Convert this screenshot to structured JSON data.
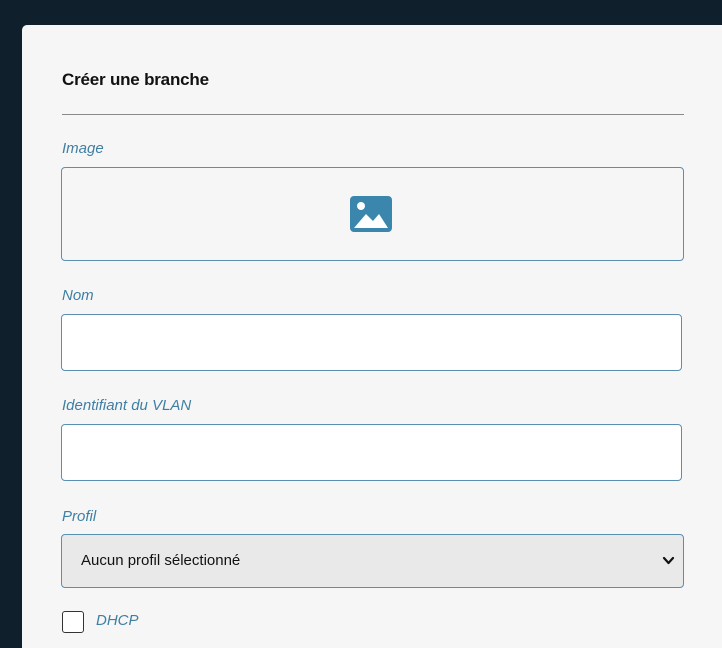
{
  "form": {
    "title": "Créer une branche",
    "image_label": "Image",
    "image_icon": "image-icon",
    "name_label": "Nom",
    "name_value": "",
    "vlan_label": "Identifiant du VLAN",
    "vlan_value": "",
    "profile_label": "Profil",
    "profile_selected": "Aucun profil sélectionné",
    "dhcp_label": "DHCP",
    "dhcp_checked": false
  },
  "colors": {
    "background": "#0f1f2b",
    "card": "#f6f6f6",
    "accent": "#3f7fa3",
    "icon": "#3a86ac",
    "border": "#5b8fb0"
  }
}
